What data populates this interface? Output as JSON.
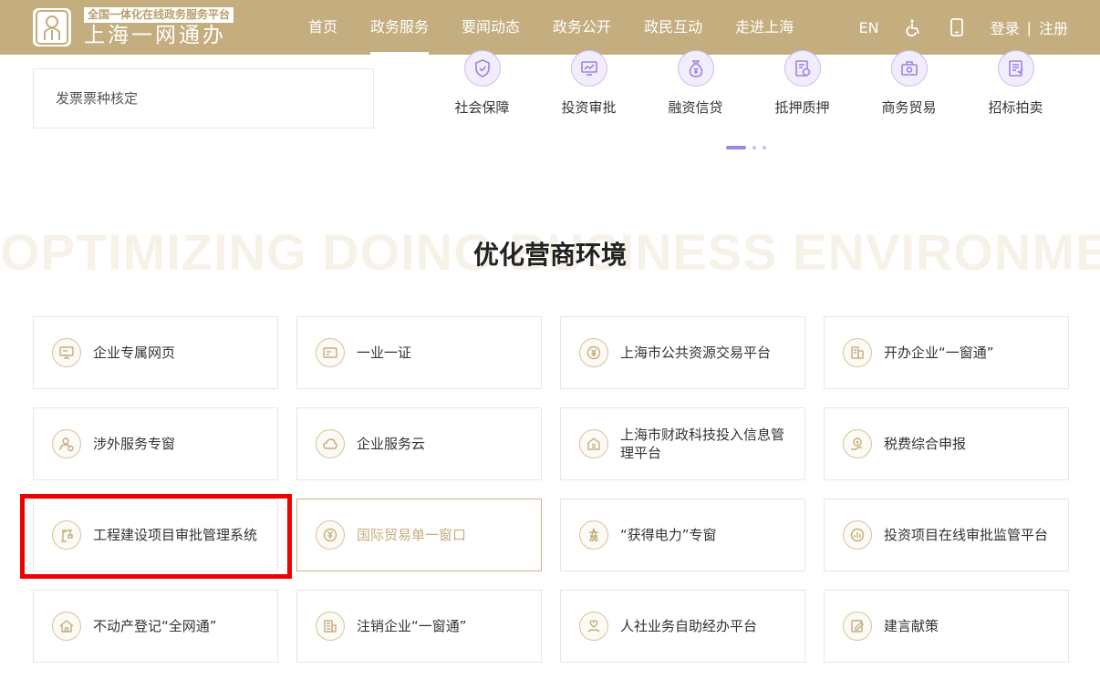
{
  "header": {
    "logo_subtitle": "全国一体化在线政务服务平台",
    "logo_title": "上海一网通办",
    "nav": [
      "首页",
      "政务服务",
      "要闻动态",
      "政务公开",
      "政民互动",
      "走进上海"
    ],
    "active_nav": "政务服务",
    "lang": "EN",
    "login": "登录",
    "separator": "|",
    "register": "注册"
  },
  "invoice_link": "发票票种核定",
  "categories": [
    "社会保障",
    "投资审批",
    "融资信贷",
    "抵押质押",
    "商务贸易",
    "招标拍卖"
  ],
  "carousel": {
    "pages": 3,
    "active": 1
  },
  "section": {
    "bg_text": "OPTIMIZING DOING BUSINESS ENVIRONMENT",
    "title": "优化营商环境"
  },
  "services": [
    "企业专属网页",
    "一业一证",
    "上海市公共资源交易平台",
    "开办企业“一窗通”",
    "涉外服务专窗",
    "企业服务云",
    "上海市财政科技投入信息管理平台",
    "税费综合申报",
    "工程建设项目审批管理系统",
    "国际贸易单一窗口",
    "“获得电力”专窗",
    "投资项目在线审批监管平台",
    "不动产登记“全网通”",
    "注销企业“一窗通”",
    "人社业务自助经办平台",
    "建言献策"
  ],
  "colors": {
    "header_bg": "#c4ad7e",
    "gold_accent": "#c4ad7e",
    "purple_icon": "#9b86e0",
    "highlight_red": "#ee0000"
  }
}
